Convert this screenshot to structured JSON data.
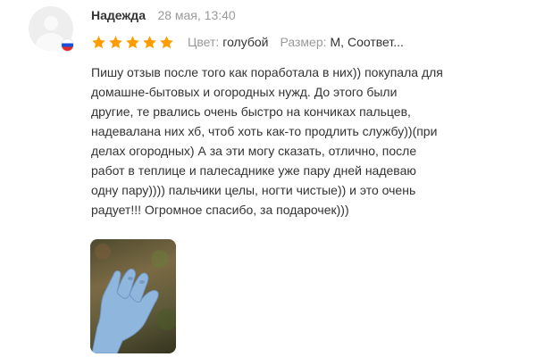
{
  "review": {
    "author": "Надежда",
    "date": "28 мая, 13:40",
    "rating": 5,
    "rating_max": 5,
    "star_color": "#ff9c00",
    "flag": "russia-flag-icon",
    "attributes": [
      {
        "key": "Цвет:",
        "value": "голубой"
      },
      {
        "key": "Размер:",
        "value": "M, Соответ..."
      }
    ],
    "text_lines": [
      "Пишу отзыв после того как поработала в них)) покупала для",
      "домашне-бытовых и огородных нужд. До этого были",
      "другие, те рвались очень быстро на кончиках пальцев,",
      "надевалана них хб, чтоб хоть как-то продлить службу))(при",
      "делах огородных) А за эти могу сказать, отлично, после",
      "работ в теплице и палесаднике уже пару дней надеваю",
      "одну пару)))) пальчики целы, ногти чистые)) и это очень",
      "радует!!! Огромное спасибо, за подарочек)))"
    ],
    "photo": "photo-blue-nitrile-glove"
  }
}
